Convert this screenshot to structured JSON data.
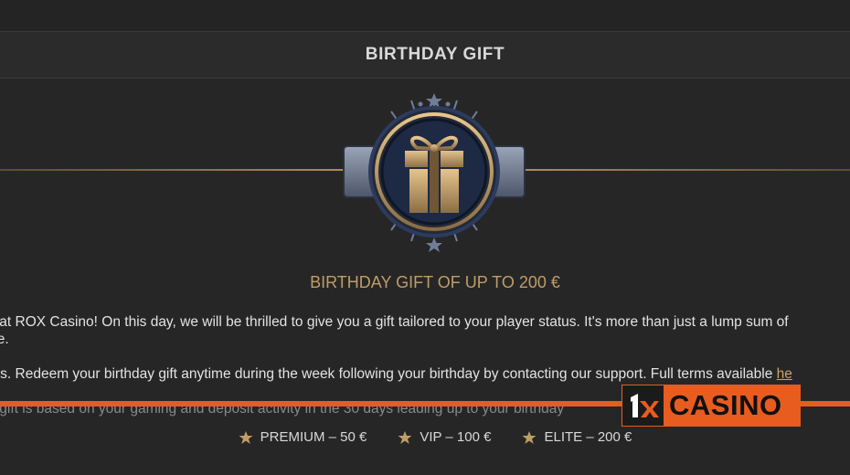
{
  "header": {
    "title": "BIRTHDAY GIFT"
  },
  "badge": {
    "icon": "gift-icon"
  },
  "subtitle": "BIRTHDAY GIFT OF UP TO 200 €",
  "paragraphs": {
    "p1_line1": "day at ROX Casino! On this day, we will be thrilled to give you a gift tailored to your player status. It's more than just a lump sum of",
    "p1_line2": "more.",
    "p2_text": "users. Redeem your birthday gift anytime during the week following your birthday by contacting our support. Full terms available ",
    "p2_link": "he",
    "p3_text": "day gift is based on your gaming and deposit activity in the 30 days leading up to your birthday"
  },
  "tiers": [
    {
      "label": "PREMIUM – 50 €"
    },
    {
      "label": "VIP – 100 €"
    },
    {
      "label": "ELITE – 200 €"
    }
  ],
  "watermark": {
    "text": "CASINO",
    "mark": "1x"
  },
  "colors": {
    "accent_gold": "#bf9d68",
    "watermark_orange": "#e95c1f",
    "badge_navy": "#1e2a44"
  }
}
